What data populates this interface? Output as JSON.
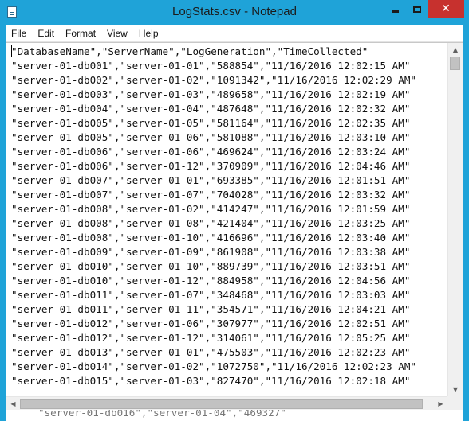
{
  "window": {
    "title": "LogStats.csv - Notepad",
    "icon": "notepad-icon",
    "accent_color": "#1fa3d8",
    "close_color": "#c7312e",
    "controls": {
      "minimize": "minimize-icon",
      "maximize": "maximize-icon",
      "close": "close-icon",
      "close_glyph": "✕"
    }
  },
  "menu": {
    "items": [
      {
        "label": "File"
      },
      {
        "label": "Edit"
      },
      {
        "label": "Format"
      },
      {
        "label": "View"
      },
      {
        "label": "Help"
      }
    ]
  },
  "document": {
    "lines": [
      "\"DatabaseName\",\"ServerName\",\"LogGeneration\",\"TimeCollected\"",
      "\"server-01-db001\",\"server-01-01\",\"588854\",\"11/16/2016 12:02:15 AM\"",
      "\"server-01-db002\",\"server-01-02\",\"1091342\",\"11/16/2016 12:02:29 AM\"",
      "\"server-01-db003\",\"server-01-03\",\"489658\",\"11/16/2016 12:02:19 AM\"",
      "\"server-01-db004\",\"server-01-04\",\"487648\",\"11/16/2016 12:02:32 AM\"",
      "\"server-01-db005\",\"server-01-05\",\"581164\",\"11/16/2016 12:02:35 AM\"",
      "\"server-01-db005\",\"server-01-06\",\"581088\",\"11/16/2016 12:03:10 AM\"",
      "\"server-01-db006\",\"server-01-06\",\"469624\",\"11/16/2016 12:03:24 AM\"",
      "\"server-01-db006\",\"server-01-12\",\"370909\",\"11/16/2016 12:04:46 AM\"",
      "\"server-01-db007\",\"server-01-01\",\"693385\",\"11/16/2016 12:01:51 AM\"",
      "\"server-01-db007\",\"server-01-07\",\"704028\",\"11/16/2016 12:03:32 AM\"",
      "\"server-01-db008\",\"server-01-02\",\"414247\",\"11/16/2016 12:01:59 AM\"",
      "\"server-01-db008\",\"server-01-08\",\"421404\",\"11/16/2016 12:03:25 AM\"",
      "\"server-01-db008\",\"server-01-10\",\"416696\",\"11/16/2016 12:03:40 AM\"",
      "\"server-01-db009\",\"server-01-09\",\"861908\",\"11/16/2016 12:03:38 AM\"",
      "\"server-01-db010\",\"server-01-10\",\"889739\",\"11/16/2016 12:03:51 AM\"",
      "\"server-01-db010\",\"server-01-12\",\"884958\",\"11/16/2016 12:04:56 AM\"",
      "\"server-01-db011\",\"server-01-07\",\"348468\",\"11/16/2016 12:03:03 AM\"",
      "\"server-01-db011\",\"server-01-11\",\"354571\",\"11/16/2016 12:04:21 AM\"",
      "\"server-01-db012\",\"server-01-06\",\"307977\",\"11/16/2016 12:02:51 AM\"",
      "\"server-01-db012\",\"server-01-12\",\"314061\",\"11/16/2016 12:05:25 AM\"",
      "\"server-01-db013\",\"server-01-01\",\"475503\",\"11/16/2016 12:02:23 AM\"",
      "\"server-01-db014\",\"server-01-02\",\"1072750\",\"11/16/2016 12:02:23 AM\"",
      "\"server-01-db015\",\"server-01-03\",\"827470\",\"11/16/2016 12:02:18 AM\""
    ],
    "partial_next_line": "\"server-01-db016\",\"server-01-04\",\"469327\""
  },
  "scrollbars": {
    "vertical": {
      "up_icon": "▲",
      "down_icon": "▼",
      "position": 0
    },
    "horizontal": {
      "left_icon": "◀",
      "right_icon": "▶",
      "position": 0
    }
  }
}
